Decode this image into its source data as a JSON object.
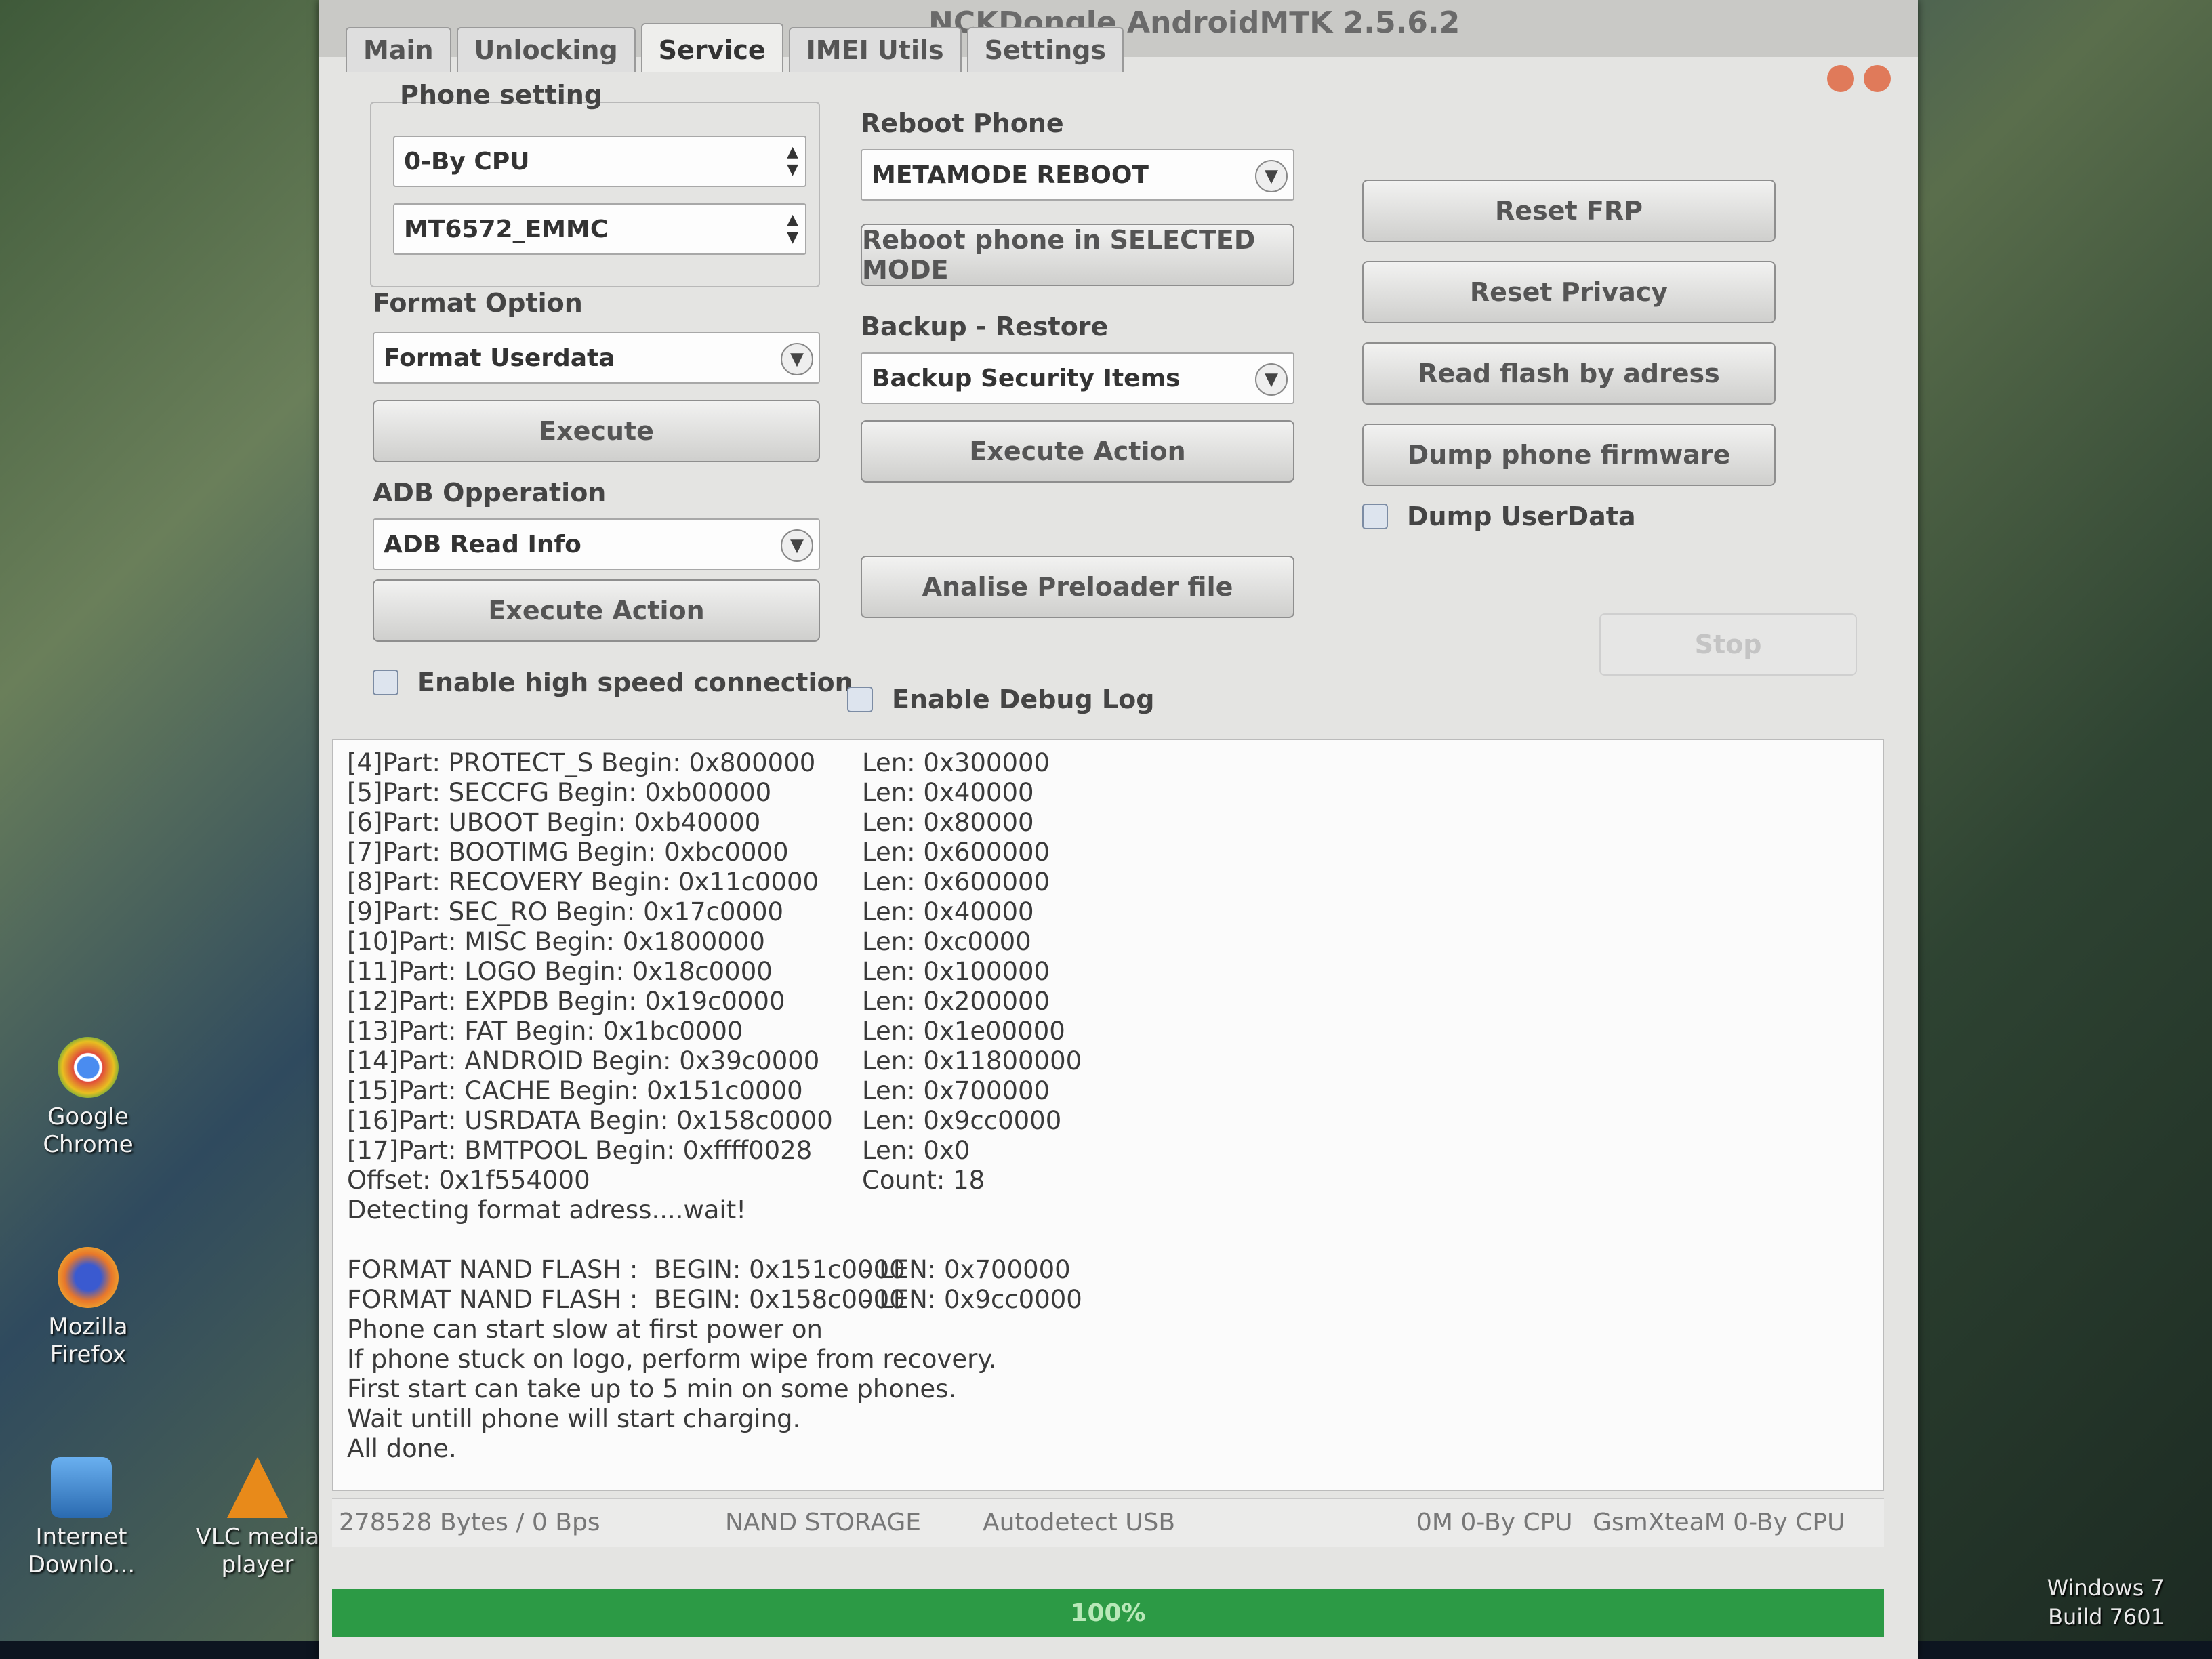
{
  "window": {
    "title": "NCKDongle AndroidMTK 2.5.6.2",
    "tabs": [
      "Main",
      "Unlocking",
      "Service",
      "IMEI Utils",
      "Settings"
    ],
    "active_tab": "Service"
  },
  "phone_setting": {
    "label": "Phone setting",
    "cpu": "0-By CPU",
    "chip": "MT6572_EMMC"
  },
  "format_option": {
    "label": "Format Option",
    "selected": "Format Userdata",
    "button": "Execute"
  },
  "adb": {
    "label": "ADB Opperation",
    "selected": "ADB Read Info",
    "button": "Execute Action"
  },
  "reboot": {
    "label": "Reboot Phone",
    "selected": "METAMODE REBOOT",
    "button": "Reboot phone in SELECTED MODE"
  },
  "backup": {
    "label": "Backup - Restore",
    "selected": "Backup Security Items",
    "button": "Execute Action"
  },
  "analise_button": "Analise Preloader file",
  "right_buttons": {
    "reset_frp": "Reset FRP",
    "reset_privacy": "Reset Privacy",
    "read_flash": "Read flash by adress",
    "dump_firmware": "Dump phone firmware",
    "dump_userdata": "Dump UserData",
    "stop": "Stop"
  },
  "checks": {
    "high_speed": "Enable high speed connection",
    "debug_log": "Enable Debug Log"
  },
  "log": [
    [
      "[4]Part: PROTECT_S Begin: 0x800000",
      "Len: 0x300000"
    ],
    [
      "[5]Part: SECCFG Begin: 0xb00000",
      "Len: 0x40000"
    ],
    [
      "[6]Part: UBOOT Begin: 0xb40000",
      "Len: 0x80000"
    ],
    [
      "[7]Part: BOOTIMG Begin: 0xbc0000",
      "Len: 0x600000"
    ],
    [
      "[8]Part: RECOVERY Begin: 0x11c0000",
      "Len: 0x600000"
    ],
    [
      "[9]Part: SEC_RO Begin: 0x17c0000",
      "Len: 0x40000"
    ],
    [
      "[10]Part: MISC Begin: 0x1800000",
      "Len: 0xc0000"
    ],
    [
      "[11]Part: LOGO Begin: 0x18c0000",
      "Len: 0x100000"
    ],
    [
      "[12]Part: EXPDB Begin: 0x19c0000",
      "Len: 0x200000"
    ],
    [
      "[13]Part: FAT Begin: 0x1bc0000",
      "Len: 0x1e00000"
    ],
    [
      "[14]Part: ANDROID Begin: 0x39c0000",
      "Len: 0x11800000"
    ],
    [
      "[15]Part: CACHE Begin: 0x151c0000",
      "Len: 0x700000"
    ],
    [
      "[16]Part: USRDATA Begin: 0x158c0000",
      "Len: 0x9cc0000"
    ],
    [
      "[17]Part: BMTPOOL Begin: 0xffff0028",
      "Len: 0x0"
    ],
    [
      "Offset: 0x1f554000",
      "Count: 18"
    ],
    [
      "Detecting format adress....wait!",
      ""
    ],
    [
      "",
      ""
    ],
    [
      "FORMAT NAND FLASH :  BEGIN: 0x151c0000",
      "- LEN: 0x700000"
    ],
    [
      "FORMAT NAND FLASH :  BEGIN: 0x158c0000",
      "- LEN: 0x9cc0000"
    ],
    [
      "Phone can start slow at first power on",
      ""
    ],
    [
      "If phone stuck on logo, perform wipe from recovery.",
      ""
    ],
    [
      "First start can take up to 5 min on some phones.",
      ""
    ],
    [
      "Wait untill phone will start charging.",
      ""
    ],
    [
      "All done.",
      ""
    ]
  ],
  "status": {
    "bytes": "278528 Bytes / 0 Bps",
    "storage": "NAND STORAGE",
    "usb": "Autodetect USB",
    "cpu": "0M 0-By CPU",
    "team": "GsmXteaM 0-By CPU"
  },
  "progress": {
    "value": 1.0,
    "label": "100%"
  },
  "desktop_icons": [
    {
      "name": "Google Chrome",
      "color": "#d9463a"
    },
    {
      "name": "Mozilla Firefox",
      "color": "#e8772a"
    },
    {
      "name": "Internet Downlo...",
      "color": "#3a8ad9"
    },
    {
      "name": "VLC media player",
      "color": "#e88a1a"
    }
  ],
  "tray_text": [
    "Windows 7",
    "Build 7601"
  ]
}
